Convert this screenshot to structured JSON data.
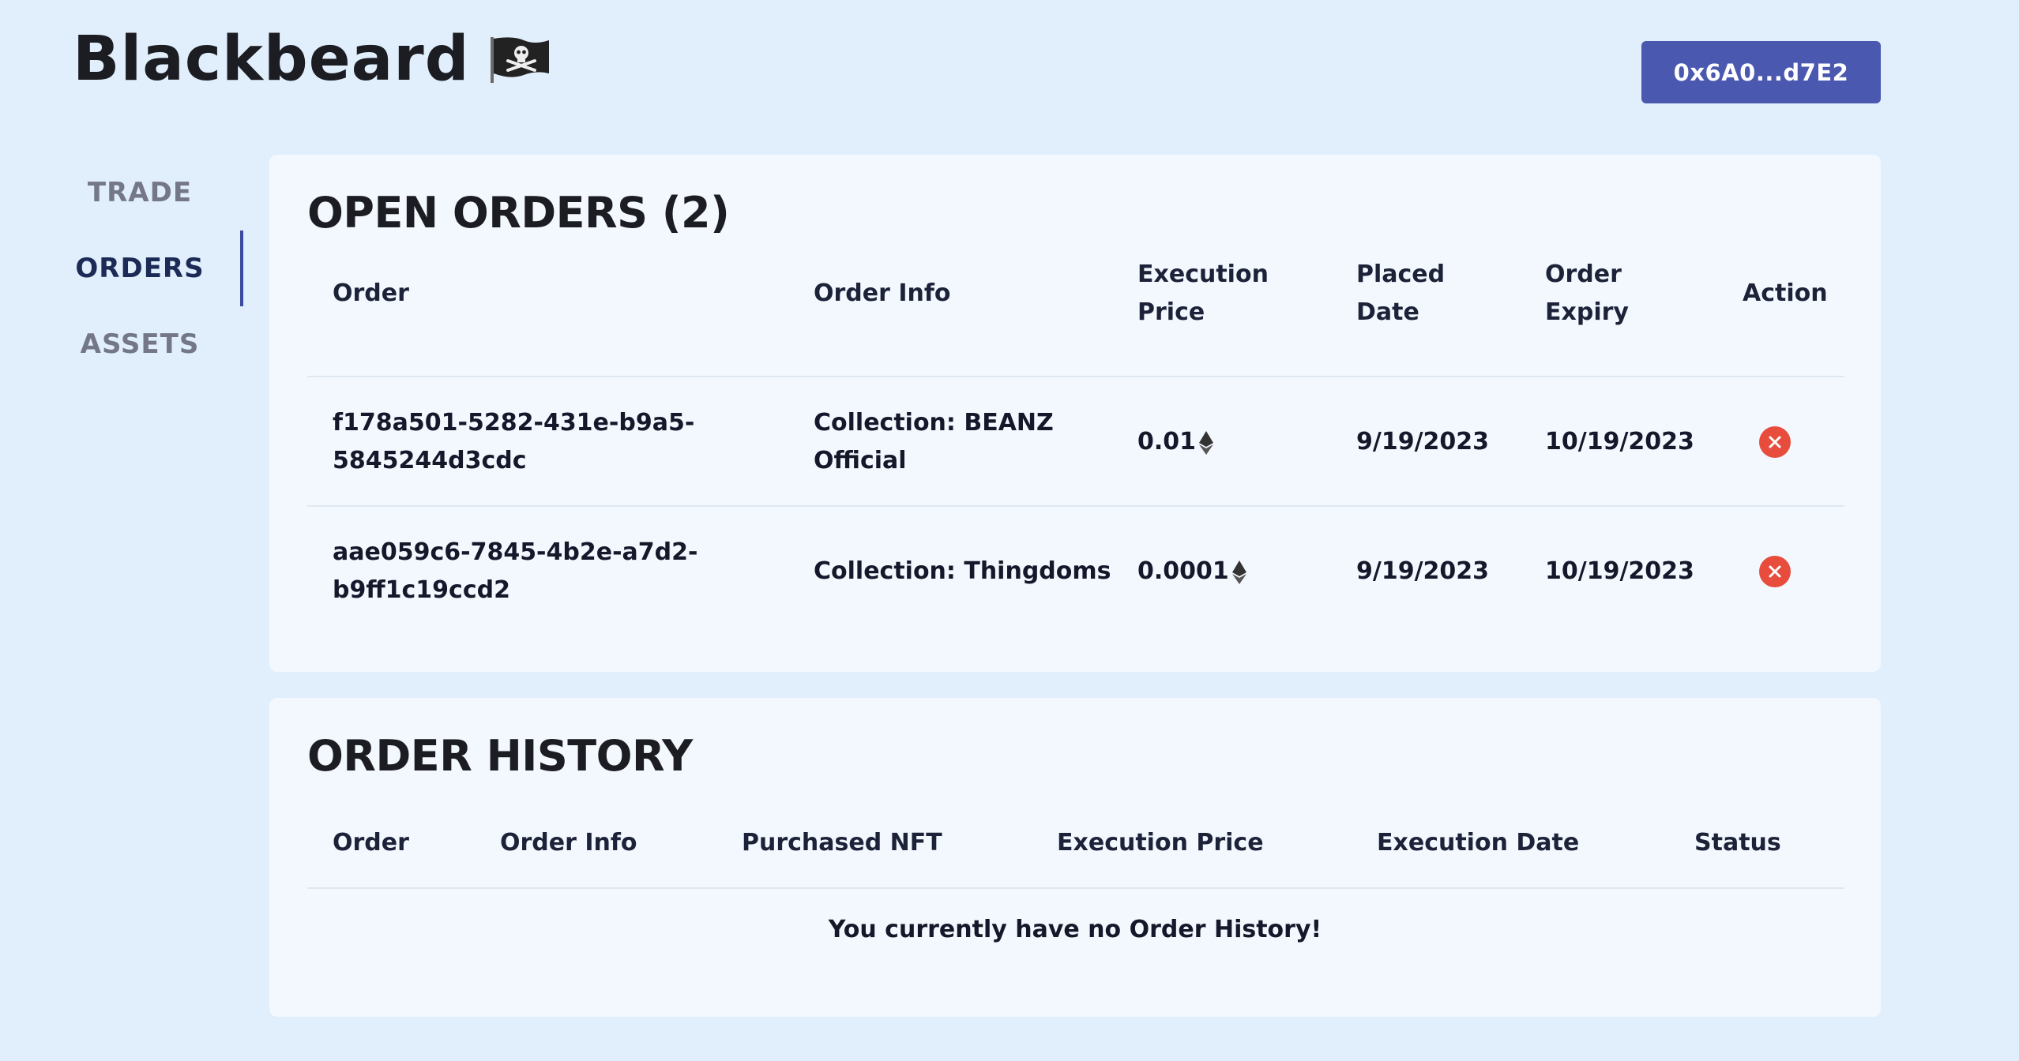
{
  "app": {
    "title": "Blackbeard",
    "logo_icon": "pirate-flag-icon"
  },
  "wallet": {
    "address_label": "0x6A0...d7E2",
    "color": "#4a58b0"
  },
  "nav": {
    "items": [
      {
        "label": "TRADE",
        "active": false
      },
      {
        "label": "ORDERS",
        "active": true
      },
      {
        "label": "ASSETS",
        "active": false
      }
    ]
  },
  "open_orders": {
    "title": "OPEN ORDERS (2)",
    "headers": {
      "order": "Order",
      "order_info": "Order Info",
      "execution_price_1": "Execution",
      "execution_price_2": "Price",
      "placed_date_1": "Placed",
      "placed_date_2": "Date",
      "order_expiry_1": "Order",
      "order_expiry_2": "Expiry",
      "action": "Action"
    },
    "rows": [
      {
        "order_line1": "f178a501-5282-431e-b9a5-",
        "order_line2": "5845244d3cdc",
        "info_line1": "Collection: BEANZ",
        "info_line2": "Official",
        "price": "0.01",
        "placed": "9/19/2023",
        "expiry": "10/19/2023"
      },
      {
        "order_line1": "aae059c6-7845-4b2e-a7d2-",
        "order_line2": "b9ff1c19ccd2",
        "info_line1": "Collection: Thingdoms",
        "price": "0.0001",
        "placed": "9/19/2023",
        "expiry": "10/19/2023"
      }
    ],
    "cancel_color": "#e74c3c"
  },
  "order_history": {
    "title": "ORDER HISTORY",
    "headers": {
      "order": "Order",
      "order_info": "Order Info",
      "purchased_nft": "Purchased NFT",
      "execution_price": "Execution Price",
      "execution_date": "Execution Date",
      "status": "Status"
    },
    "empty_message": "You currently have no Order History!"
  }
}
